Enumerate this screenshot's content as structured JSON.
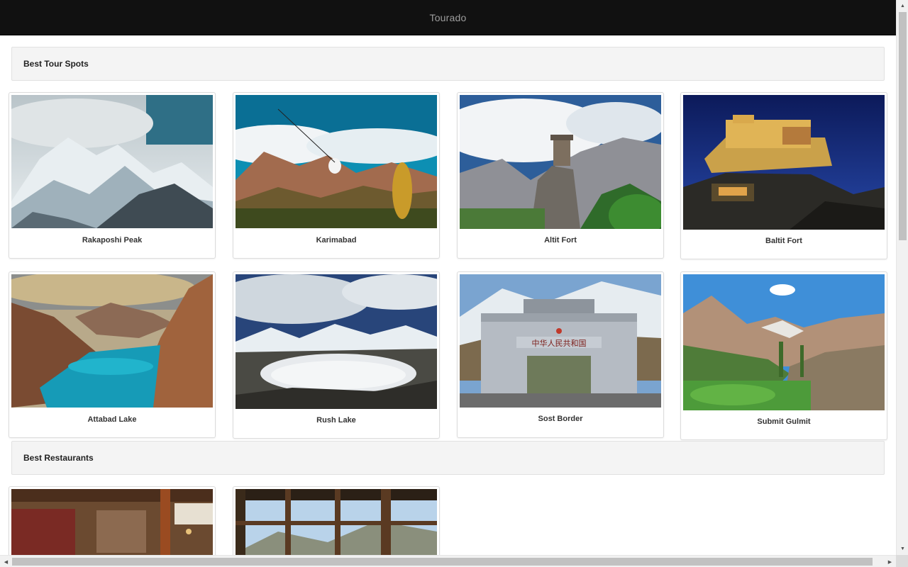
{
  "app": {
    "title": "Tourado"
  },
  "sections": {
    "tour_spots": {
      "title": "Best Tour Spots",
      "cards": [
        {
          "name": "Rakaposhi Peak"
        },
        {
          "name": "Karimabad"
        },
        {
          "name": "Altit Fort"
        },
        {
          "name": "Baltit Fort"
        },
        {
          "name": "Attabad Lake"
        },
        {
          "name": "Rush Lake"
        },
        {
          "name": "Sost Border"
        },
        {
          "name": "Submit Gulmit"
        }
      ]
    },
    "restaurants": {
      "title": "Best Restaurants"
    }
  },
  "icons": {
    "scroll_up": "triangle-up-icon",
    "scroll_down": "triangle-down-icon",
    "scroll_left": "triangle-left-icon",
    "scroll_right": "triangle-right-icon"
  },
  "colors": {
    "topbar": "#111111",
    "brand_text": "#9d9d9d",
    "section_bg": "#f4f4f4"
  }
}
